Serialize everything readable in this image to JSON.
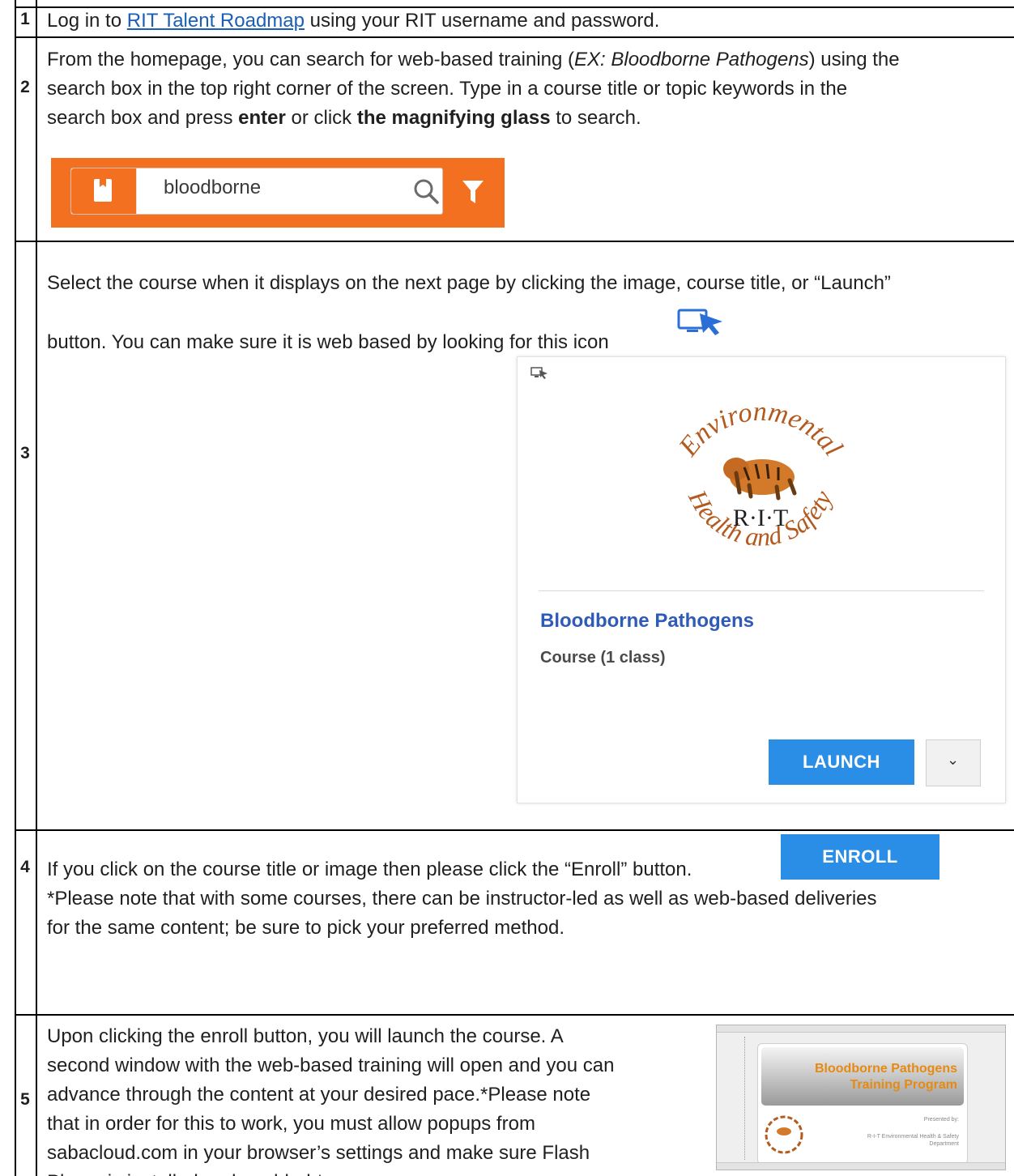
{
  "rows": [
    {
      "number": "1",
      "text_before_link": "Log in to ",
      "link_text": "RIT Talent Roadmap",
      "text_after_link": " using your RIT username and password."
    },
    {
      "number": "2",
      "line1_before_ex": "From the homepage, you can search for web-based training (",
      "ex_text": "EX: Bloodborne Pathogens",
      "line1_after_ex": ") using the",
      "line2": "search box in the top right corner of the screen. Type in a course title or topic keywords in the",
      "line3_start": "search box and press ",
      "line3_bold1": "enter",
      "line3_mid": " or click ",
      "line3_bold2": "the magnifying glass",
      "line3_end": " to search.",
      "search_box": {
        "value": "bloodborne",
        "book_icon": "book-icon",
        "search_icon": "magnifying-glass-icon",
        "filter_icon": "filter-icon",
        "bar_color": "#f37021"
      }
    },
    {
      "number": "3",
      "line1": "Select the course when it displays on the next page by clicking the image, course title, or “Launch”",
      "line2": "button. You can make sure it is web based by looking for this icon",
      "web_icon": "web-based-monitor-cursor-icon",
      "card": {
        "logo_top_text": "Environmental",
        "logo_bottom_text": "Health and Safety",
        "logo_center_text": "R·I·T",
        "title": "Bloodborne Pathogens",
        "subtitle": "Course (1 class)",
        "launch_label": "LAUNCH",
        "more_icon": "chevron-down-icon"
      }
    },
    {
      "number": "4",
      "line1": "If you click on the course title or image then please click the “Enroll” button.",
      "enroll_label": "ENROLL",
      "line2": "*Please note that with some courses, there can be instructor-led as well as web-based deliveries",
      "line3": "for the same content; be sure to pick your preferred method."
    },
    {
      "number": "5",
      "lines": [
        "Upon clicking the enroll button, you will launch the course. A",
        "second window with the web-based training will open and you can",
        "advance through the content at your desired pace.*Please note",
        "that in order for this to work, you must allow popups from",
        "sabacloud.com in your browser’s settings and make sure Flash",
        "Player is installed and enabled.*"
      ],
      "thumbnail": {
        "title_line1": "Bloodborne Pathogens",
        "title_line2": "Training Program",
        "presented_by": "Presented by:",
        "department": "R-I-T Environmental Health & Safety Department"
      }
    }
  ],
  "colors": {
    "link": "#1a5fb4",
    "button_blue": "#2b8ee6",
    "card_title": "#2f5bb7",
    "search_orange": "#f37021",
    "logo_brown": "#b35a1f"
  }
}
